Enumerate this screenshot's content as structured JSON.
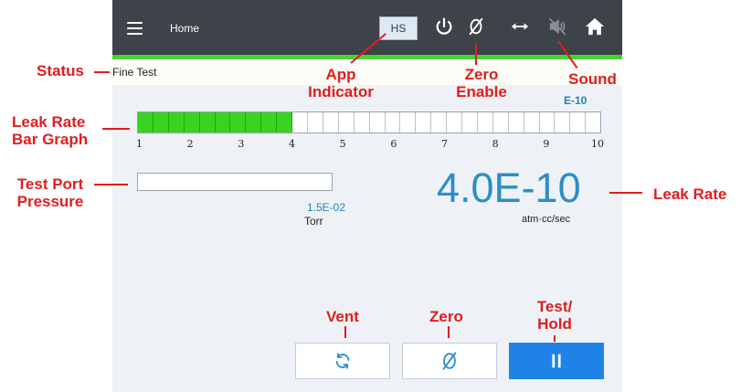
{
  "header": {
    "page_title": "Home",
    "app_indicator": "HS",
    "icons": [
      "menu-icon",
      "power-icon",
      "zero-enable-icon",
      "bidirectional-arrow-icon",
      "sound-muted-icon",
      "home-icon"
    ]
  },
  "status": {
    "text": "Fine Test"
  },
  "bar_graph": {
    "exponent_label": "E-10",
    "ticks": [
      "1",
      "2",
      "3",
      "4",
      "5",
      "6",
      "7",
      "8",
      "9",
      "10"
    ],
    "segments_total": 30,
    "segments_lit": 10
  },
  "pressure": {
    "value": "1.5E-02",
    "unit": "Torr"
  },
  "leak_rate": {
    "value": "4.0E-10",
    "unit": "atm·cc/sec"
  },
  "buttons": {
    "vent_icon": "refresh-icon",
    "zero_icon": "zero-slash-icon",
    "test_hold_icon": "pause-icon"
  },
  "annotations": {
    "status": "Status",
    "app_indicator_line1": "App",
    "app_indicator_line2": "Indicator",
    "zero_enable_line1": "Zero",
    "zero_enable_line2": "Enable",
    "sound": "Sound",
    "leak_rate_bar_line1": "Leak Rate",
    "leak_rate_bar_line2": "Bar Graph",
    "test_port_line1": "Test Port",
    "test_port_line2": "Pressure",
    "leak_rate": "Leak Rate",
    "vent": "Vent",
    "zero": "Zero",
    "test_hold_line1": "Test/",
    "test_hold_line2": "Hold"
  },
  "colors": {
    "topbar": "#3e4249",
    "accent_green": "#4cd137",
    "bar_lit": "#39d41f",
    "value_blue": "#2a8ec9",
    "button_blue": "#1f82e6",
    "annotation_red": "#e11d1d"
  }
}
